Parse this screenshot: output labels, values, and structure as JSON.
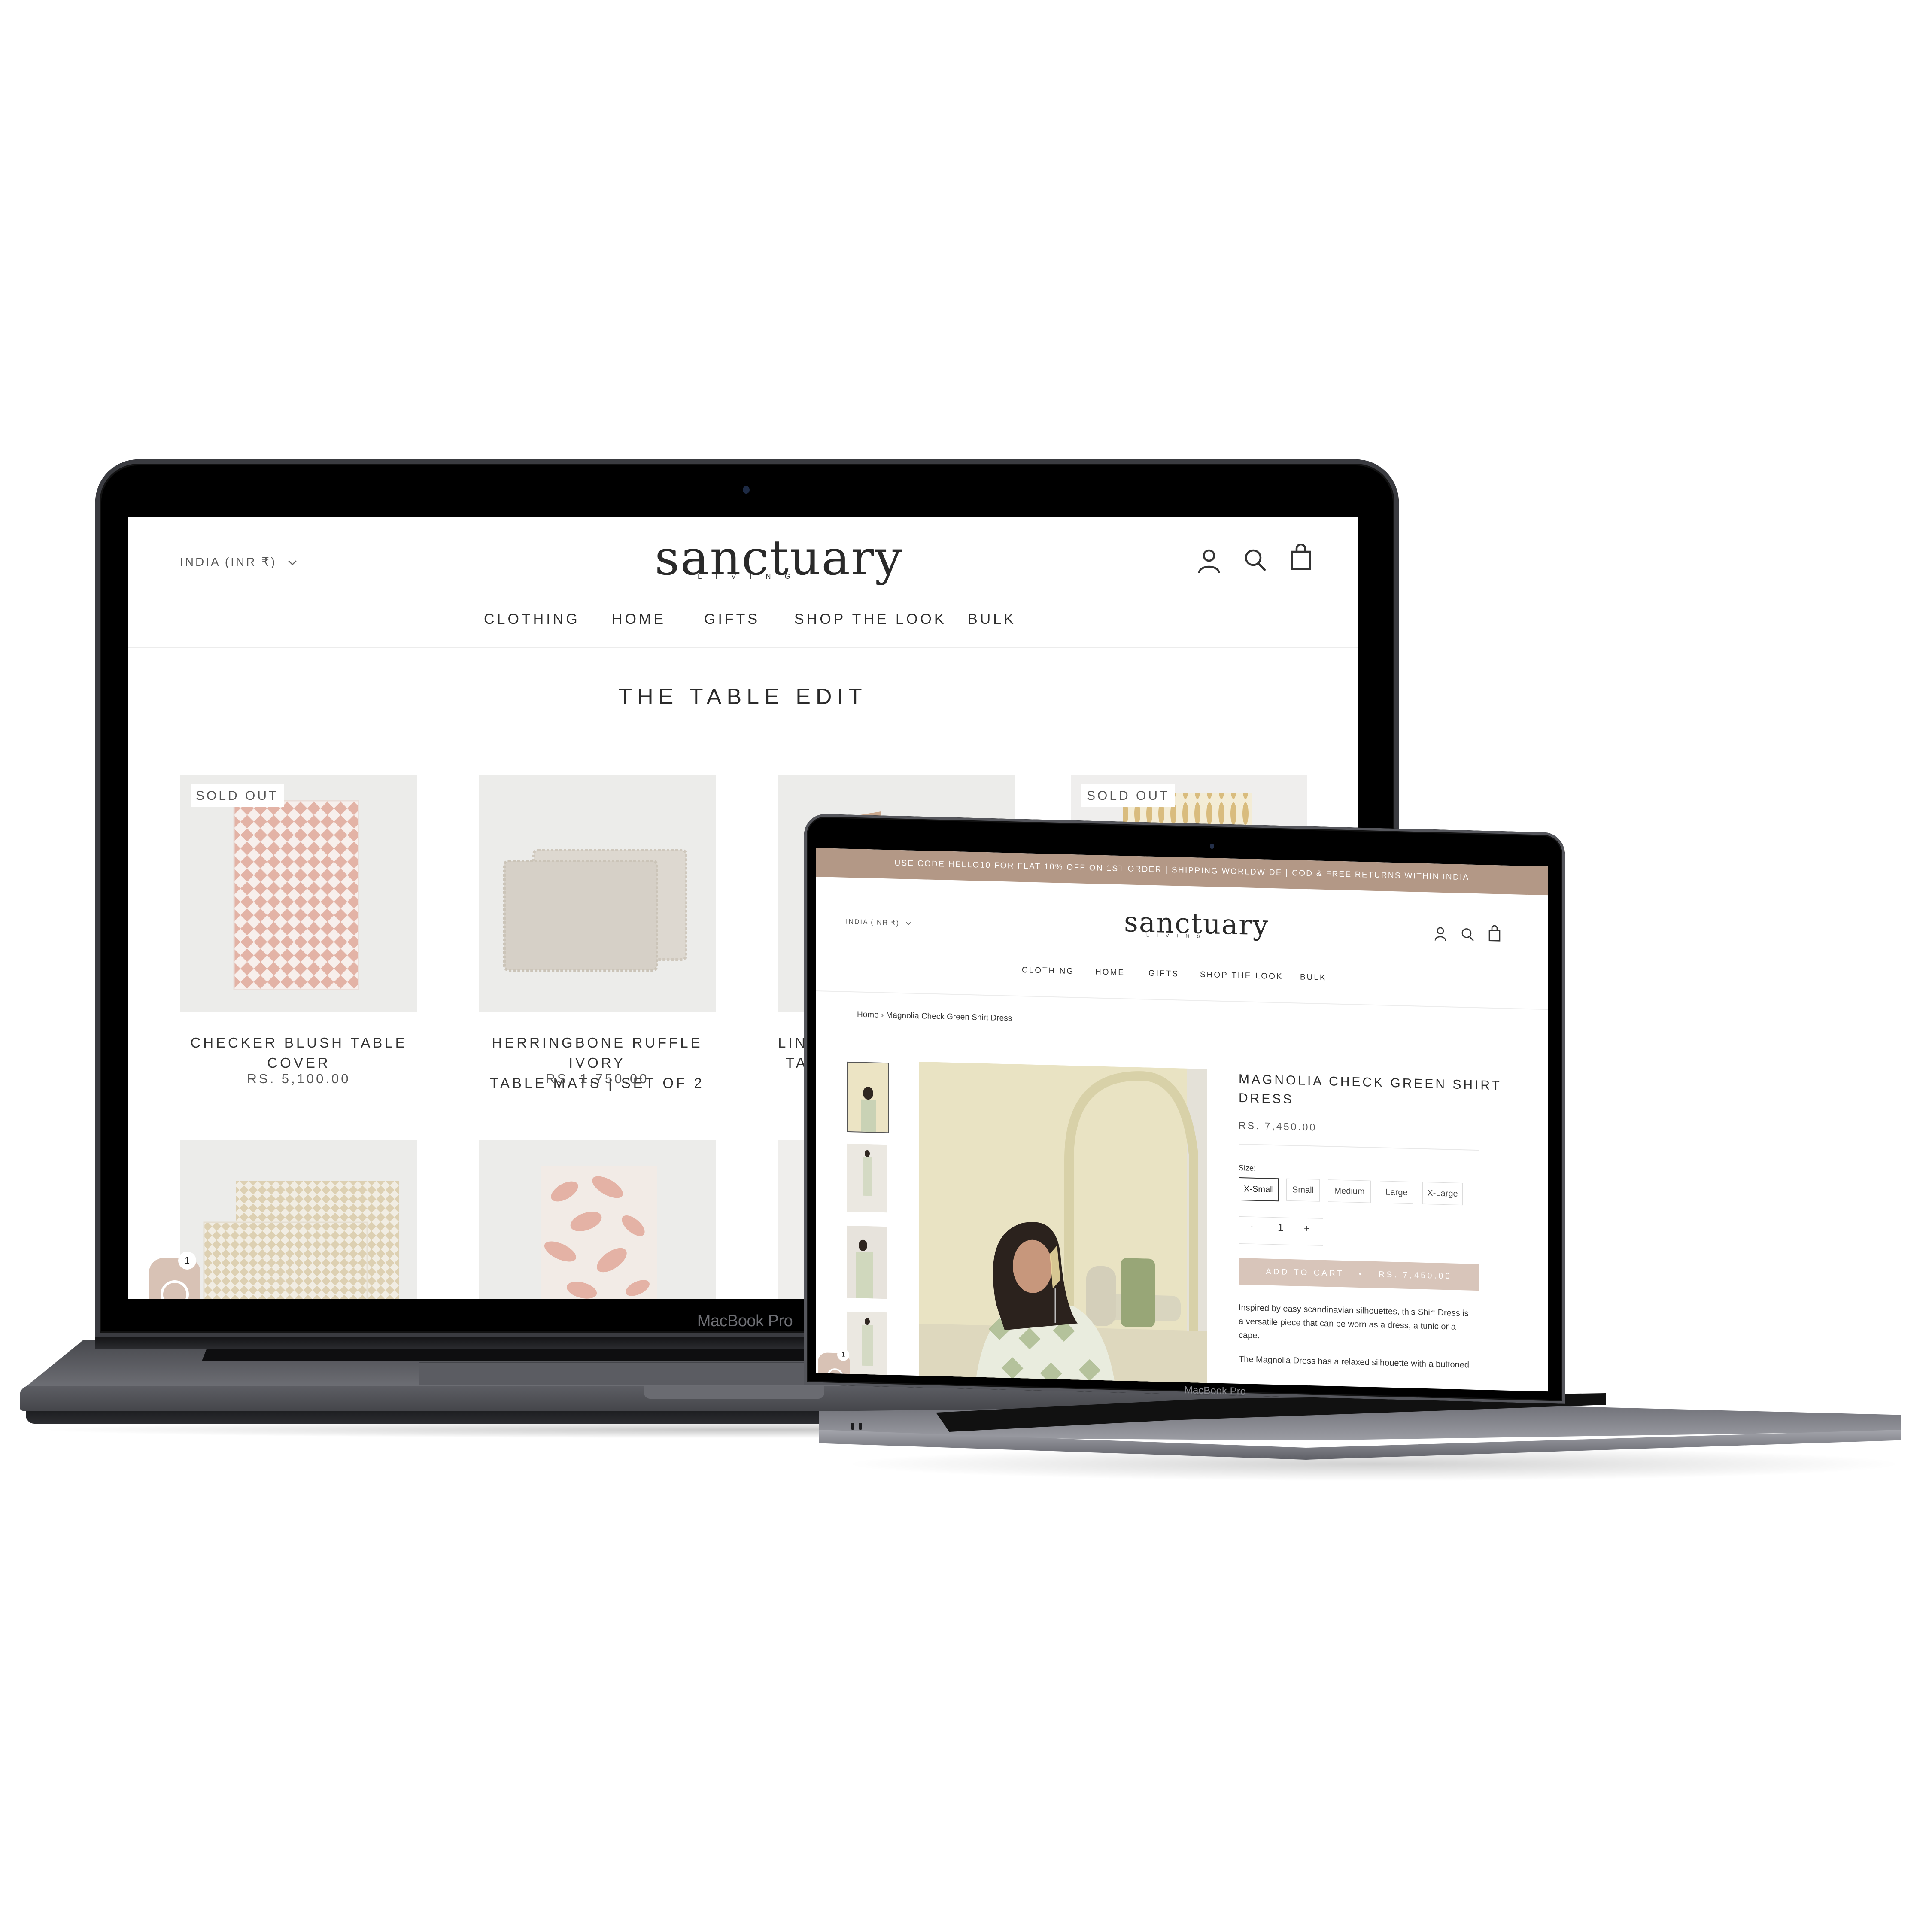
{
  "devices": {
    "big": {
      "brand_label": "MacBook Pro"
    },
    "small": {
      "brand_label": "MacBook Pro"
    }
  },
  "storefront": {
    "currency_selector": "INDIA (INR ₹)",
    "logo": {
      "name": "sanctuary",
      "tagline": "LIVING"
    },
    "nav": [
      "CLOTHING",
      "HOME",
      "GIFTS",
      "SHOP THE LOOK",
      "BULK"
    ],
    "icons": [
      "account-icon",
      "search-icon",
      "cart-icon"
    ],
    "chat_widget": {
      "unread_count": "1"
    }
  },
  "collection_page": {
    "title": "THE TABLE EDIT",
    "products": [
      {
        "title_lines": [
          "CHECKER BLUSH TABLE",
          "COVER"
        ],
        "price": "RS. 5,100.00",
        "badge": "SOLD OUT",
        "image": "pink-checker-tablecloth"
      },
      {
        "title_lines": [
          "HERRINGBONE RUFFLE IVORY",
          "TABLE MATS | SET OF 2"
        ],
        "price": "RS. 1,750.00",
        "badge": "",
        "image": "ivory-ruffle-mats"
      },
      {
        "title_lines": [
          "LINE",
          "TAB"
        ],
        "price": "",
        "badge": "",
        "image": "tan-linen"
      },
      {
        "title_lines": [],
        "price": "",
        "badge": "SOLD OUT",
        "image": "yellow-ikat-fabric"
      },
      {
        "title_lines": [],
        "price": "",
        "badge": "",
        "image": "beige-checker-mats"
      },
      {
        "title_lines": [],
        "price": "",
        "badge": "",
        "image": "pink-leaf-print"
      },
      {
        "title_lines": [],
        "price": "",
        "badge": "",
        "image": "neutral"
      }
    ]
  },
  "product_page": {
    "announcement": "USE CODE HELLO10 FOR FLAT 10% OFF ON 1ST ORDER | SHIPPING WORLDWIDE | COD & FREE RETURNS WITHIN INDIA",
    "breadcrumb": {
      "home": "Home",
      "separator": "›",
      "current": "Magnolia Check Green Shirt Dress"
    },
    "title_lines": [
      "MAGNOLIA CHECK GREEN SHIRT",
      "DRESS"
    ],
    "price": "RS. 7,450.00",
    "size_label": "Size:",
    "sizes": [
      "X-Small",
      "Small",
      "Medium",
      "Large",
      "X-Large"
    ],
    "selected_size": "X-Small",
    "quantity": {
      "minus": "−",
      "value": "1",
      "plus": "+"
    },
    "add_to_cart": {
      "label": "ADD TO CART",
      "separator": "•",
      "price": "RS. 7,450.00"
    },
    "description": [
      "Inspired by easy scandinavian silhouettes, this Shirt Dress is a versatile piece that can be worn as a dress, a tunic or a cape.",
      "The Magnolia Dress has a relaxed silhouette with a buttoned"
    ],
    "thumbnails": 4,
    "colors": {
      "banner": "#b39886",
      "cart_button": "#d8c5ba",
      "chat": "#d8c2b5"
    }
  }
}
